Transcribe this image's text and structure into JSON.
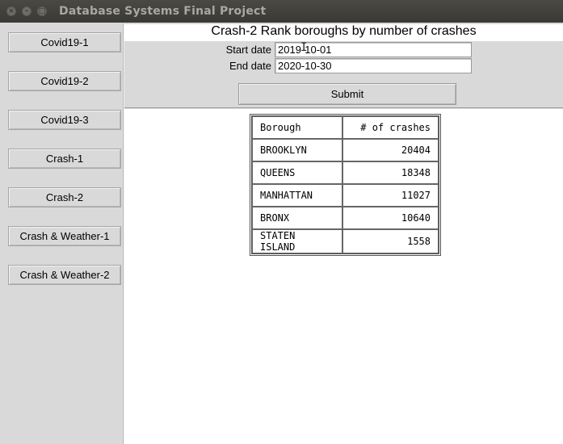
{
  "window": {
    "title": "Database Systems Final Project",
    "controls": [
      "close-icon",
      "minimize-icon",
      "maximize-icon"
    ]
  },
  "sidebar": {
    "items": [
      {
        "label": "Covid19-1"
      },
      {
        "label": "Covid19-2"
      },
      {
        "label": "Covid19-3"
      },
      {
        "label": "Crash-1"
      },
      {
        "label": "Crash-2"
      },
      {
        "label": "Crash & Weather-1"
      },
      {
        "label": "Crash & Weather-2"
      }
    ]
  },
  "form": {
    "heading": "Crash-2 Rank boroughs by number of crashes",
    "start_label": "Start date",
    "start_value": "2019-10-01",
    "end_label": "End date",
    "end_value": "2020-10-30",
    "submit_label": "Submit"
  },
  "results": {
    "columns": [
      "Borough",
      "# of crashes"
    ],
    "rows": [
      {
        "borough": "BROOKLYN",
        "crashes": "20404"
      },
      {
        "borough": "QUEENS",
        "crashes": "18348"
      },
      {
        "borough": "MANHATTAN",
        "crashes": "11027"
      },
      {
        "borough": "BRONX",
        "crashes": "10640"
      },
      {
        "borough": "STATEN ISLAND",
        "crashes": "1558"
      }
    ]
  }
}
